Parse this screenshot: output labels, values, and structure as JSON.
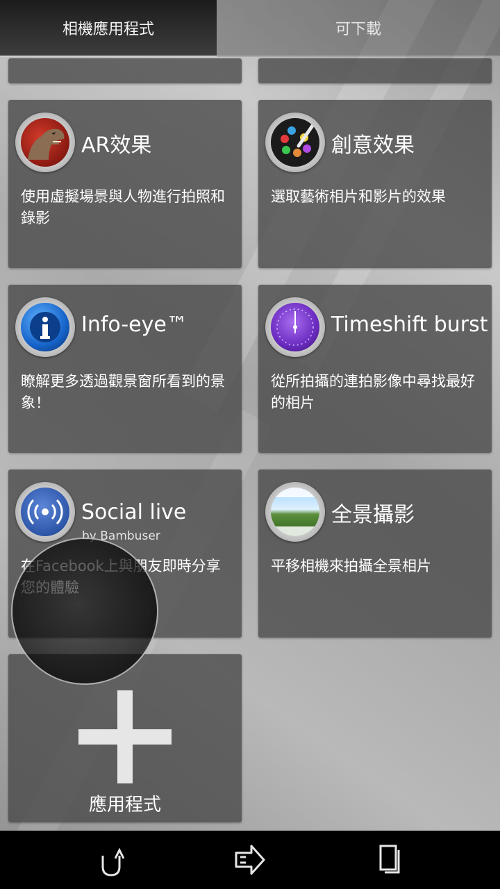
{
  "tabs": {
    "active_label": "相機應用程式",
    "inactive_label": "可下載"
  },
  "cards": [
    {
      "title": "AR效果",
      "subtitle": "",
      "description": "使用虛擬場景與人物進行拍照和錄影",
      "icon": "dinosaur-icon"
    },
    {
      "title": "創意效果",
      "subtitle": "",
      "description": "選取藝術相片和影片的效果",
      "icon": "palette-icon"
    },
    {
      "title": "Info-eye™",
      "subtitle": "",
      "description": "瞭解更多透過觀景窗所看到的景象！",
      "icon": "info-icon"
    },
    {
      "title": "Timeshift burst",
      "subtitle": "",
      "description": "從所拍攝的連拍影像中尋找最好的相片",
      "icon": "clock-icon"
    },
    {
      "title": "Social live",
      "subtitle": "by Bambuser",
      "description": "在Facebook上與朋友即時分享您的體驗",
      "icon": "broadcast-icon"
    },
    {
      "title": "全景攝影",
      "subtitle": "",
      "description": "平移相機來拍攝全景相片",
      "icon": "panorama-icon"
    }
  ],
  "add_card": {
    "label": "應用程式",
    "icon": "plus-icon"
  },
  "navbar": {
    "back_icon": "back-icon",
    "home_icon": "home-icon",
    "recent_icon": "recent-apps-icon"
  },
  "colors": {
    "card_bg": "#4a4a4a",
    "navbar_bg": "#000000",
    "text": "#ffffff"
  }
}
